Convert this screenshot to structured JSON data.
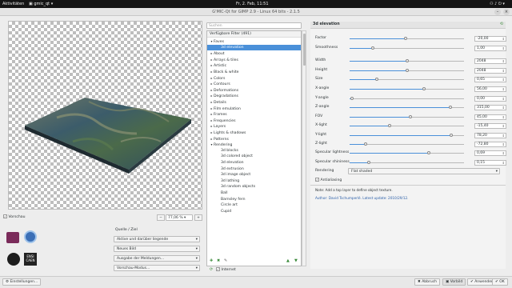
{
  "topbar": {
    "activities": "Aktivitäten",
    "app": "gmic_qt",
    "clock": "Fr, 2. Feb, 11:51"
  },
  "window": {
    "title": "G'MIC-Qt for GIMP 2.9 - Linux 64 bits - 2.1.5"
  },
  "preview": {
    "checkbox_label": "Vorschau",
    "checked": true,
    "zoom": "77,06 %"
  },
  "io": {
    "header": "Quelle / Ziel",
    "input_mode": "Aktive und darüber liegende",
    "output_mode": "Neues Bild",
    "messages": "Ausgabe der Meldungen...",
    "preview_mode": "Vorschau-Modus..."
  },
  "logos": {
    "a": "GREYC",
    "b": "CNRS",
    "c": "UNICAEN",
    "d": "ENSI CAEN"
  },
  "search": {
    "placeholder": "Suchen"
  },
  "filters": {
    "header": "Verfügbare Filter (491)",
    "items": [
      {
        "label": "Faves",
        "level": 0,
        "open": true
      },
      {
        "label": "3d elevation",
        "level": 1,
        "selected": true
      },
      {
        "label": "About",
        "level": 0
      },
      {
        "label": "Arrays & tiles",
        "level": 0
      },
      {
        "label": "Artistic",
        "level": 0
      },
      {
        "label": "Black & white",
        "level": 0
      },
      {
        "label": "Colors",
        "level": 0
      },
      {
        "label": "Contours",
        "level": 0
      },
      {
        "label": "Deformations",
        "level": 0
      },
      {
        "label": "Degradations",
        "level": 0
      },
      {
        "label": "Details",
        "level": 0
      },
      {
        "label": "Film emulation",
        "level": 0
      },
      {
        "label": "Frames",
        "level": 0
      },
      {
        "label": "Frequencies",
        "level": 0
      },
      {
        "label": "Layers",
        "level": 0
      },
      {
        "label": "Lights & shadows",
        "level": 0
      },
      {
        "label": "Patterns",
        "level": 0
      },
      {
        "label": "Rendering",
        "level": 0,
        "open": true
      },
      {
        "label": "3d blocks",
        "level": 1
      },
      {
        "label": "3d colored object",
        "level": 1
      },
      {
        "label": "3d elevation",
        "level": 1
      },
      {
        "label": "3d extrusion",
        "level": 1
      },
      {
        "label": "3d image object",
        "level": 1
      },
      {
        "label": "3d lathing",
        "level": 1
      },
      {
        "label": "3d random objects",
        "level": 1
      },
      {
        "label": "Ball",
        "level": 1
      },
      {
        "label": "Barnsley fern",
        "level": 1
      },
      {
        "label": "Circle art",
        "level": 1
      },
      {
        "label": "Cupid",
        "level": 1
      }
    ],
    "internet_label": "Internet"
  },
  "params": {
    "title": "3d elevation",
    "sliders": [
      {
        "label": "Factor",
        "value": "-20,00",
        "frac": 0.49
      },
      {
        "label": "Smoothness",
        "value": "1,00",
        "frac": 0.2
      },
      {
        "label": "Width",
        "value": "2048",
        "frac": 0.5
      },
      {
        "label": "Height",
        "value": "2048",
        "frac": 0.5
      },
      {
        "label": "Size",
        "value": "0,65",
        "frac": 0.24
      },
      {
        "label": "X-angle",
        "value": "56,00",
        "frac": 0.65
      },
      {
        "label": "Y-angle",
        "value": "0,00",
        "frac": 0.02
      },
      {
        "label": "Z-angle",
        "value": "315,00",
        "frac": 0.88
      },
      {
        "label": "FOV",
        "value": "45,00",
        "frac": 0.53
      },
      {
        "label": "X-light",
        "value": "-15,40",
        "frac": 0.35
      },
      {
        "label": "Y-light",
        "value": "78,20",
        "frac": 0.89
      },
      {
        "label": "Z-light",
        "value": "-72,80",
        "frac": 0.14
      },
      {
        "label": "Specular lightness",
        "value": "0,69",
        "frac": 0.69
      },
      {
        "label": "Specular shininess",
        "value": "0,15",
        "frac": 0.17
      }
    ],
    "rendering_label": "Rendering",
    "rendering_value": "Flat shaded",
    "antialiasing": "Antialiasing",
    "note": "Note: Add a top layer to define object texture.",
    "author": "Author: David Tschumperlé.   Latest update: 2010/29/12."
  },
  "footer": {
    "settings": "Einstellungen...",
    "cancel": "Abbruch",
    "apply_preview": "Vorbild",
    "apply": "Anwenden",
    "ok": "OK"
  }
}
